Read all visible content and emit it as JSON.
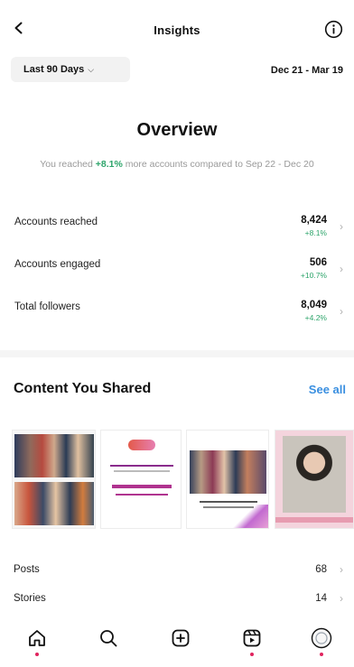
{
  "header": {
    "title": "Insights",
    "back_icon": "chevron-left-icon",
    "info_icon": "info-icon"
  },
  "filter": {
    "range_label": "Last 90 Days",
    "range_dates": "Dec 21 - Mar 19"
  },
  "overview": {
    "title": "Overview",
    "subtitle_prefix": "You reached ",
    "subtitle_pct": "+8.1%",
    "subtitle_suffix": " more accounts compared to Sep 22 - Dec 20"
  },
  "metrics": [
    {
      "label": "Accounts reached",
      "value": "8,424",
      "change": "+8.1%"
    },
    {
      "label": "Accounts engaged",
      "value": "506",
      "change": "+10.7%"
    },
    {
      "label": "Total followers",
      "value": "8,049",
      "change": "+4.2%"
    }
  ],
  "content": {
    "title": "Content You Shared",
    "see_all": "See all"
  },
  "counts": [
    {
      "label": "Posts",
      "value": "68"
    },
    {
      "label": "Stories",
      "value": "14"
    }
  ],
  "tabbar": {
    "items": [
      "home-icon",
      "search-icon",
      "create-icon",
      "reels-icon",
      "profile-avatar"
    ]
  },
  "colors": {
    "positive": "#2ea56b",
    "link": "#3a8fe0",
    "notification": "#e0245e"
  }
}
